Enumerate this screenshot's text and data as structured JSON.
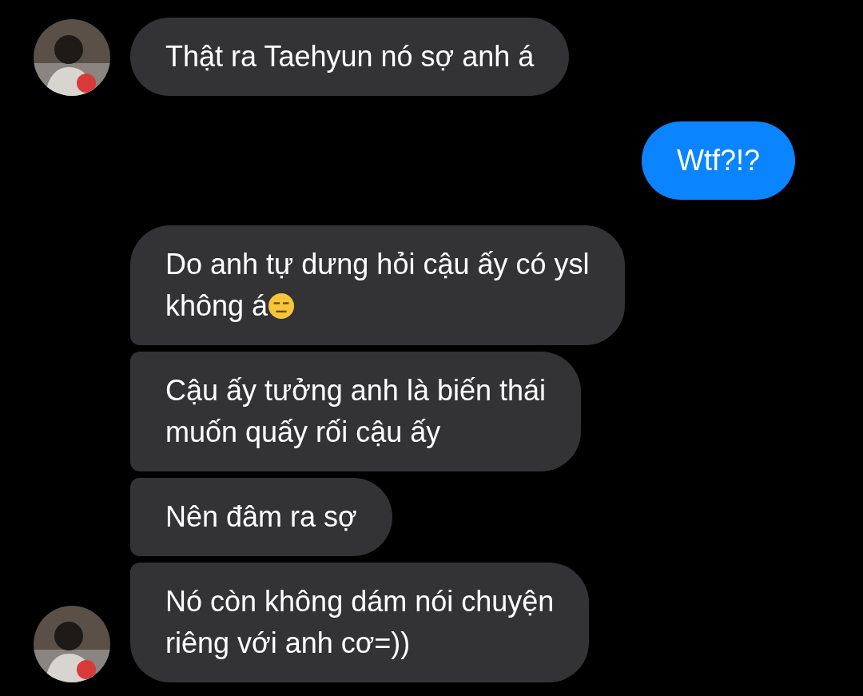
{
  "messages": [
    {
      "kind": "incoming",
      "avatar": true,
      "text": "Thật ra Taehyun nó sợ anh á"
    },
    {
      "kind": "outgoing",
      "text": "Wtf?!?"
    },
    {
      "kind": "incoming",
      "text": "Do anh tự dưng hỏi cậu ấy có ysl\nkhông á",
      "trailing_emoji": true
    },
    {
      "kind": "incoming",
      "text": "Cậu ấy tưởng anh là biến thái\nmuốn quấy rối cậu ấy"
    },
    {
      "kind": "incoming",
      "text": "Nên đâm ra sợ"
    },
    {
      "kind": "incoming",
      "avatar": true,
      "text": "Nó còn không dám nói chuyện\nriêng với anh cơ=))"
    }
  ]
}
